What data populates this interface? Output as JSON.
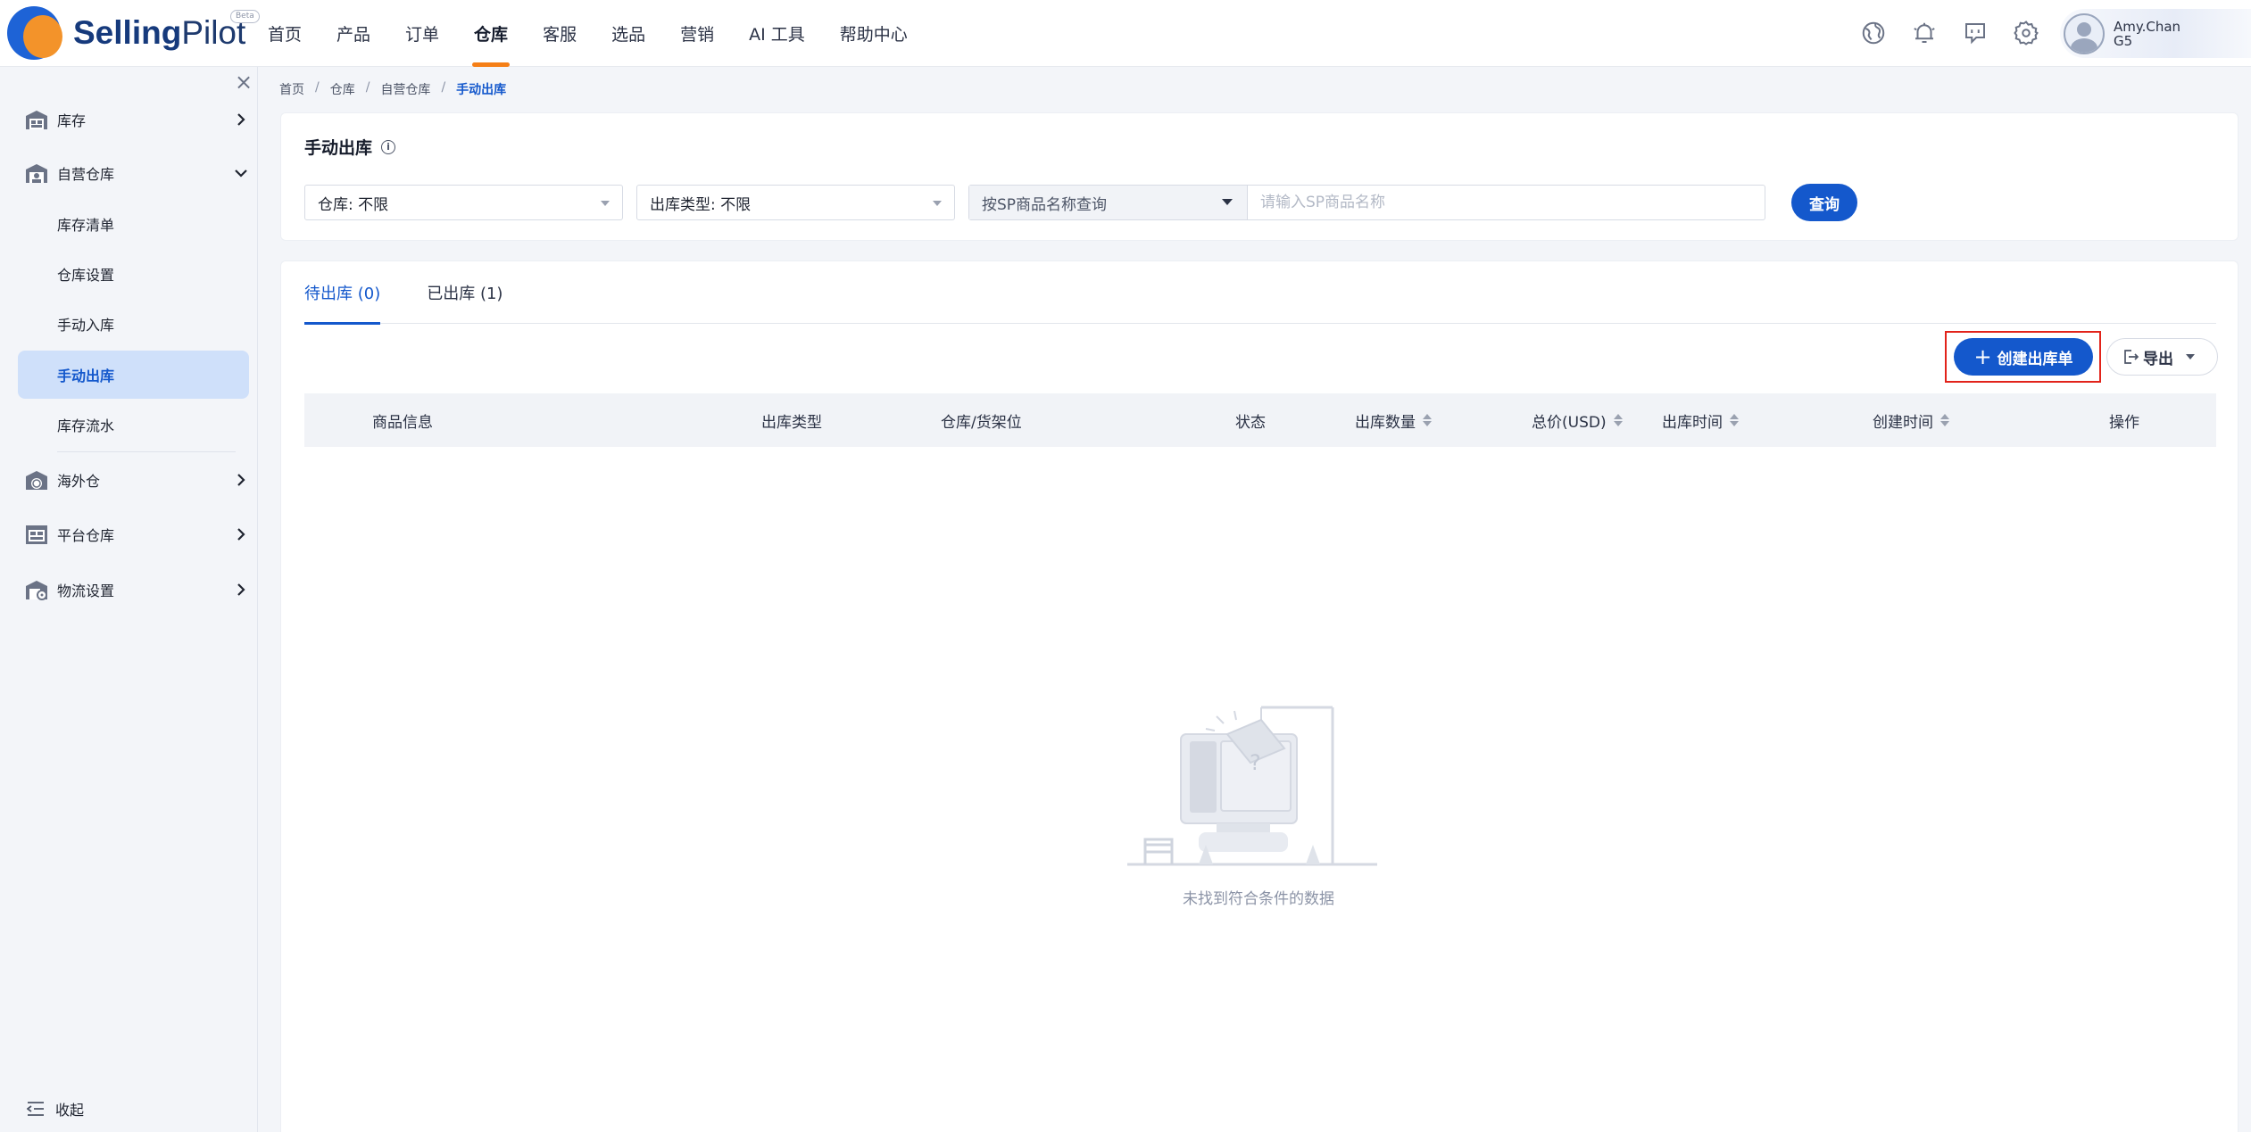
{
  "brand": {
    "name_bold": "Selling",
    "name_rest": "Pilot",
    "badge": "Beta"
  },
  "nav": [
    "首页",
    "产品",
    "订单",
    "仓库",
    "客服",
    "选品",
    "营销",
    "AI 工具",
    "帮助中心"
  ],
  "nav_active": "仓库",
  "user": {
    "name": "Amy.Chan",
    "sub": "G5"
  },
  "sidebar": {
    "close_glyph": "×",
    "groups": [
      {
        "label": "库存",
        "expanded": false
      },
      {
        "label": "自营仓库",
        "expanded": true
      },
      {
        "label": "海外仓",
        "expanded": false
      },
      {
        "label": "平台仓库",
        "expanded": false
      },
      {
        "label": "物流设置",
        "expanded": false
      }
    ],
    "sub_items": [
      "库存清单",
      "仓库设置",
      "手动入库",
      "手动出库",
      "库存流水"
    ],
    "active_sub": "手动出库",
    "collapse_label": "收起"
  },
  "breadcrumb": [
    "首页",
    "仓库",
    "自营仓库",
    "手动出库"
  ],
  "page_title": "手动出库",
  "filters": {
    "warehouse": "仓库: 不限",
    "outbound_type": "出库类型: 不限",
    "search_type": "按SP商品名称查询",
    "search_placeholder": "请输入SP商品名称",
    "query_button": "查询"
  },
  "tabs": [
    {
      "label": "待出库 (0)",
      "active": true
    },
    {
      "label": "已出库 (1)",
      "active": false
    }
  ],
  "actions": {
    "create": "创建出库单",
    "export": "导出"
  },
  "table": {
    "columns": [
      {
        "label": "商品信息",
        "sortable": false
      },
      {
        "label": "出库类型",
        "sortable": false
      },
      {
        "label": "仓库/货架位",
        "sortable": false
      },
      {
        "label": "状态",
        "sortable": false
      },
      {
        "label": "出库数量",
        "sortable": true
      },
      {
        "label": "总价(USD)",
        "sortable": true
      },
      {
        "label": "出库时间",
        "sortable": true
      },
      {
        "label": "创建时间",
        "sortable": true
      },
      {
        "label": "操作",
        "sortable": false
      }
    ],
    "rows": []
  },
  "empty_text": "未找到符合条件的数据",
  "colors": {
    "primary": "#1458cc",
    "accent": "#f57f17",
    "highlight": "#e2231a"
  }
}
